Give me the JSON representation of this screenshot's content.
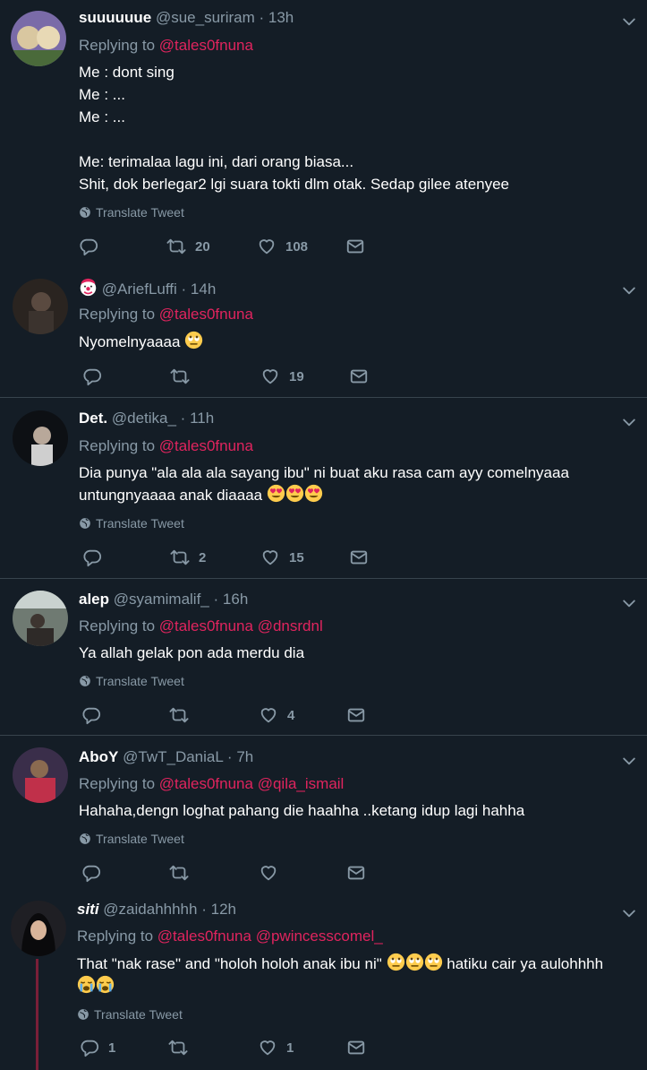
{
  "colors": {
    "background": "#141d26",
    "accent_mention": "#e0245e",
    "muted": "#8899a6",
    "divider": "#38444d"
  },
  "tweets": [
    {
      "name": "suuuuuue",
      "handle": "@sue_suriram",
      "time": "13h",
      "replying_label": "Replying to",
      "mentions": [
        "@tales0fnuna"
      ],
      "lines": [
        "Me : dont sing",
        "Me : ...",
        "Me : ...",
        "",
        "Me: terimalaa lagu ini, dari orang biasa...",
        "Shit, dok berlegar2 lgi suara tokti dlm otak. Sedap gilee atenyee"
      ],
      "translate": "Translate Tweet",
      "replies": "",
      "retweets": "20",
      "likes": "108"
    },
    {
      "name": "",
      "handle": "@AriefLuffi",
      "time": "14h",
      "replying_label": "Replying to",
      "mentions": [
        "@tales0fnuna"
      ],
      "text": "Nyomelnyaaaa",
      "replies": "",
      "retweets": "",
      "likes": "19"
    },
    {
      "name": "Det.",
      "handle": "@detika_",
      "time": "11h",
      "replying_label": "Replying to",
      "mentions": [
        "@tales0fnuna"
      ],
      "lines": [
        "Dia punya \"ala ala ala sayang ibu\" ni buat aku rasa cam ayy comelnyaaa",
        "untungnyaaaa anak diaaaa"
      ],
      "translate": "Translate Tweet",
      "replies": "",
      "retweets": "2",
      "likes": "15"
    },
    {
      "name": "alep",
      "handle": "@syamimalif_",
      "time": "16h",
      "replying_label": "Replying to",
      "mentions": [
        "@tales0fnuna",
        "@dnsrdnl"
      ],
      "text": "Ya allah gelak pon ada merdu dia",
      "translate": "Translate Tweet",
      "replies": "",
      "retweets": "",
      "likes": "4"
    },
    {
      "name": "AboY",
      "handle": "@TwT_DaniaL",
      "time": "7h",
      "replying_label": "Replying to",
      "mentions": [
        "@tales0fnuna",
        "@qila_ismail"
      ],
      "text": "Hahaha,dengn loghat pahang die haahha ..ketang idup lagi hahha",
      "translate": "Translate Tweet",
      "replies": "",
      "retweets": "",
      "likes": ""
    },
    {
      "name": "siti",
      "handle": "@zaidahhhhh",
      "time": "12h",
      "replying_label": "Replying to",
      "mentions": [
        "@tales0fnuna",
        "@pwincesscomel_"
      ],
      "text_a": "That \"nak rase\" and \"holoh holoh anak ibu ni\"",
      "text_b": "hatiku cair ya aulohhhh",
      "translate": "Translate Tweet",
      "replies": "1",
      "retweets": "",
      "likes": "1"
    }
  ]
}
